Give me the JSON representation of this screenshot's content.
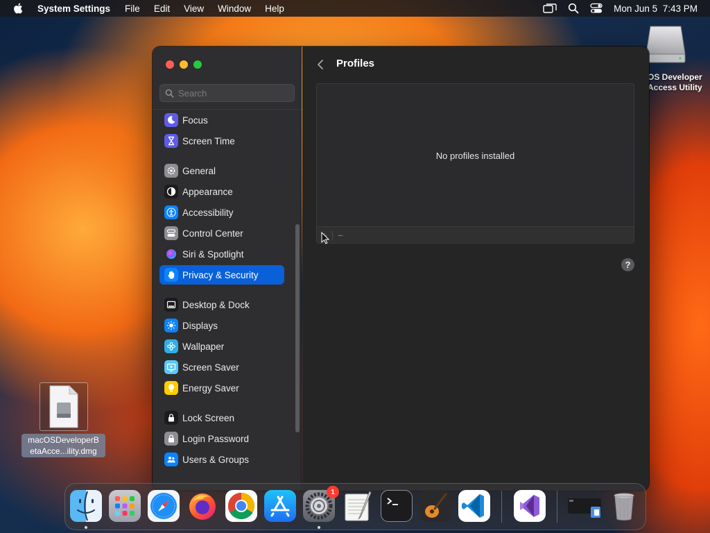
{
  "menubar": {
    "app_name": "System Settings",
    "menus": [
      "File",
      "Edit",
      "View",
      "Window",
      "Help"
    ],
    "date": "Mon Jun 5",
    "time": "7:43 PM"
  },
  "desktop": {
    "drive_label_line1": "OS Developer",
    "drive_label_line2": "Access Utility",
    "dmg_label_line1": "macOSDeveloperB",
    "dmg_label_line2": "etaAcce...ility.dmg"
  },
  "sidebar": {
    "search_placeholder": "Search",
    "items": [
      {
        "label": "Focus",
        "icon": "moon-icon",
        "color": "#5e5ce6"
      },
      {
        "label": "Screen Time",
        "icon": "hourglass-icon",
        "color": "#5e5ce6"
      },
      {
        "label": "General",
        "icon": "gear-icon",
        "color": "#8e8e93"
      },
      {
        "label": "Appearance",
        "icon": "appearance-icon",
        "color": "#1c1c1e"
      },
      {
        "label": "Accessibility",
        "icon": "accessibility-icon",
        "color": "#0a84ff"
      },
      {
        "label": "Control Center",
        "icon": "control-center-icon",
        "color": "#8e8e93"
      },
      {
        "label": "Siri & Spotlight",
        "icon": "siri-icon",
        "color": "#2c2c2e"
      },
      {
        "label": "Privacy & Security",
        "icon": "hand-icon",
        "color": "#0a84ff"
      },
      {
        "label": "Desktop & Dock",
        "icon": "dock-icon",
        "color": "#1c1c1e"
      },
      {
        "label": "Displays",
        "icon": "sun-icon",
        "color": "#0a84ff"
      },
      {
        "label": "Wallpaper",
        "icon": "wallpaper-icon",
        "color": "#32ade6"
      },
      {
        "label": "Screen Saver",
        "icon": "screen-saver-icon",
        "color": "#5ac8fa"
      },
      {
        "label": "Energy Saver",
        "icon": "lightbulb-icon",
        "color": "#ffcc00"
      },
      {
        "label": "Lock Screen",
        "icon": "lock-icon",
        "color": "#1c1c1e"
      },
      {
        "label": "Login Password",
        "icon": "lock-icon",
        "color": "#8e8e93"
      },
      {
        "label": "Users & Groups",
        "icon": "users-icon",
        "color": "#0a84ff"
      }
    ]
  },
  "content": {
    "title": "Profiles",
    "empty_message": "No profiles installed",
    "add_button": "+",
    "remove_button": "−",
    "help_button": "?"
  },
  "dock": {
    "apps": [
      "Finder",
      "Launchpad",
      "Safari",
      "Firefox",
      "Chrome",
      "App Store",
      "System Settings",
      "TextEdit",
      "Terminal",
      "GarageBand",
      "Visual Studio Code",
      "Visual Studio",
      "Downloads",
      "Trash"
    ],
    "settings_badge": "1"
  },
  "colors": {
    "selection": "#0a60d8",
    "sidebar_bg": "#2e2d2f",
    "content_bg": "#252526"
  }
}
